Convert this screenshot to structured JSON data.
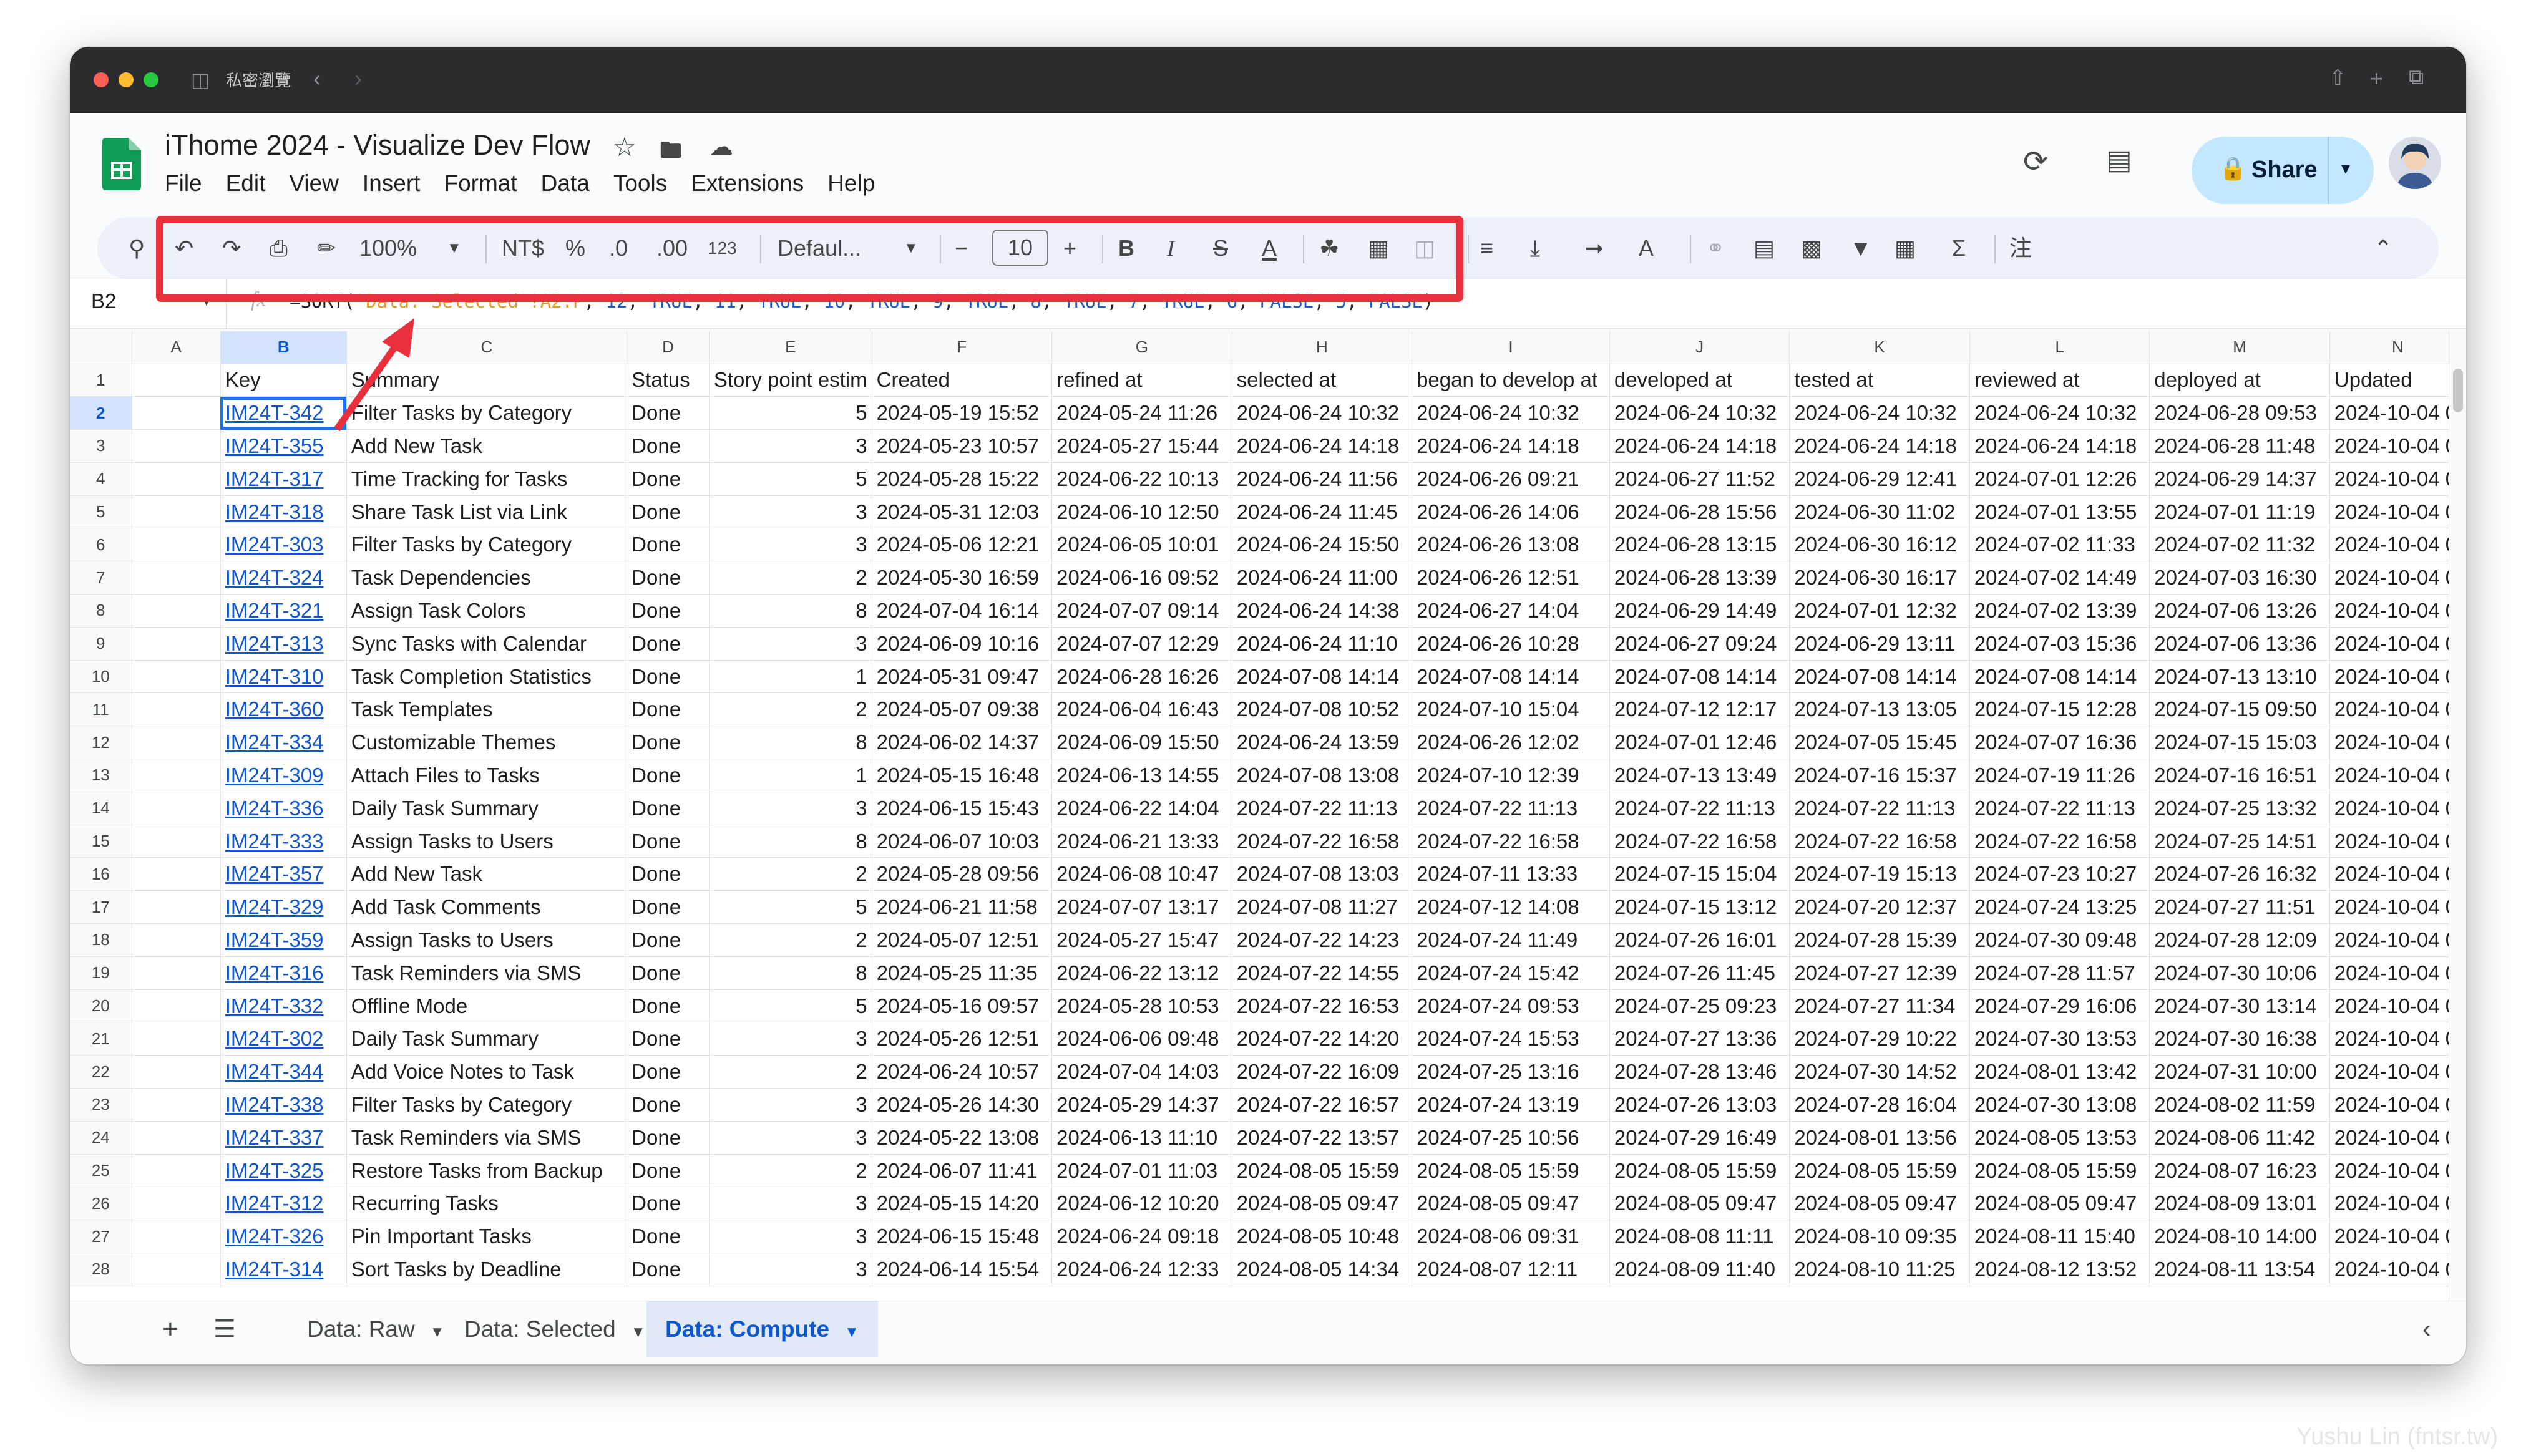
{
  "window": {
    "private_label": "私密瀏覽",
    "traffic_lights": [
      "#ff5f57",
      "#febc2e",
      "#28c840"
    ]
  },
  "app": {
    "title": "iThome 2024 - Visualize Dev Flow",
    "menus": [
      "File",
      "Edit",
      "View",
      "Insert",
      "Format",
      "Data",
      "Tools",
      "Extensions",
      "Help"
    ],
    "share_label": "Share"
  },
  "toolbar": {
    "zoom": "100%",
    "currency": "NT$",
    "percent": "%",
    "dec_less": ".0",
    "dec_more": ".00",
    "format_123": "123",
    "font": "Defaul...",
    "font_size": "10"
  },
  "formula_bar": {
    "cell_ref": "B2",
    "fx": "fx",
    "formula_parts": [
      {
        "t": "=SORT(",
        "c": "#1f1f1f"
      },
      {
        "t": "'Data: Selected'",
        "c": "#e59d27"
      },
      {
        "t": "!A2:P",
        "c": "#e59d27"
      },
      {
        "t": ", ",
        "c": "#1f1f1f"
      },
      {
        "t": "12",
        "c": "#1c5cc9"
      },
      {
        "t": ", ",
        "c": "#1f1f1f"
      },
      {
        "t": "TRUE",
        "c": "#1c5cc9"
      },
      {
        "t": ", ",
        "c": "#1f1f1f"
      },
      {
        "t": "11",
        "c": "#1c5cc9"
      },
      {
        "t": ", ",
        "c": "#1f1f1f"
      },
      {
        "t": "TRUE",
        "c": "#1c5cc9"
      },
      {
        "t": ", ",
        "c": "#1f1f1f"
      },
      {
        "t": "10",
        "c": "#1c5cc9"
      },
      {
        "t": ", ",
        "c": "#1f1f1f"
      },
      {
        "t": "TRUE",
        "c": "#1c5cc9"
      },
      {
        "t": ", ",
        "c": "#1f1f1f"
      },
      {
        "t": "9",
        "c": "#1c5cc9"
      },
      {
        "t": ", ",
        "c": "#1f1f1f"
      },
      {
        "t": "TRUE",
        "c": "#1c5cc9"
      },
      {
        "t": ", ",
        "c": "#1f1f1f"
      },
      {
        "t": "8",
        "c": "#1c5cc9"
      },
      {
        "t": ", ",
        "c": "#1f1f1f"
      },
      {
        "t": "TRUE",
        "c": "#1c5cc9"
      },
      {
        "t": ", ",
        "c": "#1f1f1f"
      },
      {
        "t": "7",
        "c": "#1c5cc9"
      },
      {
        "t": ", ",
        "c": "#1f1f1f"
      },
      {
        "t": "TRUE",
        "c": "#1c5cc9"
      },
      {
        "t": ", ",
        "c": "#1f1f1f"
      },
      {
        "t": "6",
        "c": "#1c5cc9"
      },
      {
        "t": ", ",
        "c": "#1f1f1f"
      },
      {
        "t": "FALSE",
        "c": "#1c5cc9"
      },
      {
        "t": ", ",
        "c": "#1f1f1f"
      },
      {
        "t": "5",
        "c": "#1c5cc9"
      },
      {
        "t": ", ",
        "c": "#1f1f1f"
      },
      {
        "t": "FALSE",
        "c": "#1c5cc9"
      },
      {
        "t": ")",
        "c": "#1f1f1f"
      }
    ]
  },
  "grid": {
    "column_letters": [
      "A",
      "B",
      "C",
      "D",
      "E",
      "F",
      "G",
      "H",
      "I",
      "J",
      "K",
      "L",
      "M",
      "N"
    ],
    "headers": [
      "",
      "Key",
      "Summary",
      "Status",
      "Story point estim",
      "Created",
      "refined at",
      "selected at",
      "began to develop at",
      "developed at",
      "tested at",
      "reviewed at",
      "deployed at",
      "Updated"
    ],
    "rows": [
      [
        "IM24T-342",
        "Filter Tasks by Category",
        "Done",
        "5",
        "2024-05-19 15:52",
        "2024-05-24 11:26",
        "2024-06-24 10:32",
        "2024-06-24 10:32",
        "2024-06-24 10:32",
        "2024-06-24 10:32",
        "2024-06-24 10:32",
        "2024-06-28 09:53",
        "2024-10-04 0"
      ],
      [
        "IM24T-355",
        "Add New Task",
        "Done",
        "3",
        "2024-05-23 10:57",
        "2024-05-27 15:44",
        "2024-06-24 14:18",
        "2024-06-24 14:18",
        "2024-06-24 14:18",
        "2024-06-24 14:18",
        "2024-06-24 14:18",
        "2024-06-28 11:48",
        "2024-10-04 0"
      ],
      [
        "IM24T-317",
        "Time Tracking for Tasks",
        "Done",
        "5",
        "2024-05-28 15:22",
        "2024-06-22 10:13",
        "2024-06-24 11:56",
        "2024-06-26 09:21",
        "2024-06-27 11:52",
        "2024-06-29 12:41",
        "2024-07-01 12:26",
        "2024-06-29 14:37",
        "2024-10-04 0"
      ],
      [
        "IM24T-318",
        "Share Task List via Link",
        "Done",
        "3",
        "2024-05-31 12:03",
        "2024-06-10 12:50",
        "2024-06-24 11:45",
        "2024-06-26 14:06",
        "2024-06-28 15:56",
        "2024-06-30 11:02",
        "2024-07-01 13:55",
        "2024-07-01 11:19",
        "2024-10-04 0"
      ],
      [
        "IM24T-303",
        "Filter Tasks by Category",
        "Done",
        "3",
        "2024-05-06 12:21",
        "2024-06-05 10:01",
        "2024-06-24 15:50",
        "2024-06-26 13:08",
        "2024-06-28 13:15",
        "2024-06-30 16:12",
        "2024-07-02 11:33",
        "2024-07-02 11:32",
        "2024-10-04 0"
      ],
      [
        "IM24T-324",
        "Task Dependencies",
        "Done",
        "2",
        "2024-05-30 16:59",
        "2024-06-16 09:52",
        "2024-06-24 11:00",
        "2024-06-26 12:51",
        "2024-06-28 13:39",
        "2024-06-30 16:17",
        "2024-07-02 14:49",
        "2024-07-03 16:30",
        "2024-10-04 0"
      ],
      [
        "IM24T-321",
        "Assign Task Colors",
        "Done",
        "8",
        "2024-07-04 16:14",
        "2024-07-07 09:14",
        "2024-06-24 14:38",
        "2024-06-27 14:04",
        "2024-06-29 14:49",
        "2024-07-01 12:32",
        "2024-07-02 13:39",
        "2024-07-06 13:26",
        "2024-10-04 0"
      ],
      [
        "IM24T-313",
        "Sync Tasks with Calendar",
        "Done",
        "3",
        "2024-06-09 10:16",
        "2024-07-07 12:29",
        "2024-06-24 11:10",
        "2024-06-26 10:28",
        "2024-06-27 09:24",
        "2024-06-29 13:11",
        "2024-07-03 15:36",
        "2024-07-06 13:36",
        "2024-10-04 0"
      ],
      [
        "IM24T-310",
        "Task Completion Statistics",
        "Done",
        "1",
        "2024-05-31 09:47",
        "2024-06-28 16:26",
        "2024-07-08 14:14",
        "2024-07-08 14:14",
        "2024-07-08 14:14",
        "2024-07-08 14:14",
        "2024-07-08 14:14",
        "2024-07-13 13:10",
        "2024-10-04 0"
      ],
      [
        "IM24T-360",
        "Task Templates",
        "Done",
        "2",
        "2024-05-07 09:38",
        "2024-06-04 16:43",
        "2024-07-08 10:52",
        "2024-07-10 15:04",
        "2024-07-12 12:17",
        "2024-07-13 13:05",
        "2024-07-15 12:28",
        "2024-07-15 09:50",
        "2024-10-04 0"
      ],
      [
        "IM24T-334",
        "Customizable Themes",
        "Done",
        "8",
        "2024-06-02 14:37",
        "2024-06-09 15:50",
        "2024-06-24 13:59",
        "2024-06-26 12:02",
        "2024-07-01 12:46",
        "2024-07-05 15:45",
        "2024-07-07 16:36",
        "2024-07-15 15:03",
        "2024-10-04 0"
      ],
      [
        "IM24T-309",
        "Attach Files to Tasks",
        "Done",
        "1",
        "2024-05-15 16:48",
        "2024-06-13 14:55",
        "2024-07-08 13:08",
        "2024-07-10 12:39",
        "2024-07-13 13:49",
        "2024-07-16 15:37",
        "2024-07-19 11:26",
        "2024-07-16 16:51",
        "2024-10-04 0"
      ],
      [
        "IM24T-336",
        "Daily Task Summary",
        "Done",
        "3",
        "2024-06-15 15:43",
        "2024-06-22 14:04",
        "2024-07-22 11:13",
        "2024-07-22 11:13",
        "2024-07-22 11:13",
        "2024-07-22 11:13",
        "2024-07-22 11:13",
        "2024-07-25 13:32",
        "2024-10-04 0"
      ],
      [
        "IM24T-333",
        "Assign Tasks to Users",
        "Done",
        "8",
        "2024-06-07 10:03",
        "2024-06-21 13:33",
        "2024-07-22 16:58",
        "2024-07-22 16:58",
        "2024-07-22 16:58",
        "2024-07-22 16:58",
        "2024-07-22 16:58",
        "2024-07-25 14:51",
        "2024-10-04 0"
      ],
      [
        "IM24T-357",
        "Add New Task",
        "Done",
        "2",
        "2024-05-28 09:56",
        "2024-06-08 10:47",
        "2024-07-08 13:03",
        "2024-07-11 13:33",
        "2024-07-15 15:04",
        "2024-07-19 15:13",
        "2024-07-23 10:27",
        "2024-07-26 16:32",
        "2024-10-04 0"
      ],
      [
        "IM24T-329",
        "Add Task Comments",
        "Done",
        "5",
        "2024-06-21 11:58",
        "2024-07-07 13:17",
        "2024-07-08 11:27",
        "2024-07-12 14:08",
        "2024-07-15 13:12",
        "2024-07-20 12:37",
        "2024-07-24 13:25",
        "2024-07-27 11:51",
        "2024-10-04 0"
      ],
      [
        "IM24T-359",
        "Assign Tasks to Users",
        "Done",
        "2",
        "2024-05-07 12:51",
        "2024-05-27 15:47",
        "2024-07-22 14:23",
        "2024-07-24 11:49",
        "2024-07-26 16:01",
        "2024-07-28 15:39",
        "2024-07-30 09:48",
        "2024-07-28 12:09",
        "2024-10-04 0"
      ],
      [
        "IM24T-316",
        "Task Reminders via SMS",
        "Done",
        "8",
        "2024-05-25 11:35",
        "2024-06-22 13:12",
        "2024-07-22 14:55",
        "2024-07-24 15:42",
        "2024-07-26 11:45",
        "2024-07-27 12:39",
        "2024-07-28 11:57",
        "2024-07-30 10:06",
        "2024-10-04 0"
      ],
      [
        "IM24T-332",
        "Offline Mode",
        "Done",
        "5",
        "2024-05-16 09:57",
        "2024-05-28 10:53",
        "2024-07-22 16:53",
        "2024-07-24 09:53",
        "2024-07-25 09:23",
        "2024-07-27 11:34",
        "2024-07-29 16:06",
        "2024-07-30 13:14",
        "2024-10-04 0"
      ],
      [
        "IM24T-302",
        "Daily Task Summary",
        "Done",
        "3",
        "2024-05-26 12:51",
        "2024-06-06 09:48",
        "2024-07-22 14:20",
        "2024-07-24 15:53",
        "2024-07-27 13:36",
        "2024-07-29 10:22",
        "2024-07-30 13:53",
        "2024-07-30 16:38",
        "2024-10-04 0"
      ],
      [
        "IM24T-344",
        "Add Voice Notes to Task",
        "Done",
        "2",
        "2024-06-24 10:57",
        "2024-07-04 14:03",
        "2024-07-22 16:09",
        "2024-07-25 13:16",
        "2024-07-28 13:46",
        "2024-07-30 14:52",
        "2024-08-01 13:42",
        "2024-07-31 10:00",
        "2024-10-04 0"
      ],
      [
        "IM24T-338",
        "Filter Tasks by Category",
        "Done",
        "3",
        "2024-05-26 14:30",
        "2024-05-29 14:37",
        "2024-07-22 16:57",
        "2024-07-24 13:19",
        "2024-07-26 13:03",
        "2024-07-28 16:04",
        "2024-07-30 13:08",
        "2024-08-02 11:59",
        "2024-10-04 0"
      ],
      [
        "IM24T-337",
        "Task Reminders via SMS",
        "Done",
        "3",
        "2024-05-22 13:08",
        "2024-06-13 11:10",
        "2024-07-22 13:57",
        "2024-07-25 10:56",
        "2024-07-29 16:49",
        "2024-08-01 13:56",
        "2024-08-05 13:53",
        "2024-08-06 11:42",
        "2024-10-04 0"
      ],
      [
        "IM24T-325",
        "Restore Tasks from Backup",
        "Done",
        "2",
        "2024-06-07 11:41",
        "2024-07-01 11:03",
        "2024-08-05 15:59",
        "2024-08-05 15:59",
        "2024-08-05 15:59",
        "2024-08-05 15:59",
        "2024-08-05 15:59",
        "2024-08-07 16:23",
        "2024-10-04 0"
      ],
      [
        "IM24T-312",
        "Recurring Tasks",
        "Done",
        "3",
        "2024-05-15 14:20",
        "2024-06-12 10:20",
        "2024-08-05 09:47",
        "2024-08-05 09:47",
        "2024-08-05 09:47",
        "2024-08-05 09:47",
        "2024-08-05 09:47",
        "2024-08-09 13:01",
        "2024-10-04 0"
      ],
      [
        "IM24T-326",
        "Pin Important Tasks",
        "Done",
        "3",
        "2024-06-15 15:48",
        "2024-06-24 09:18",
        "2024-08-05 10:48",
        "2024-08-06 09:31",
        "2024-08-08 11:11",
        "2024-08-10 09:35",
        "2024-08-11 15:40",
        "2024-08-10 14:00",
        "2024-10-04 0"
      ],
      [
        "IM24T-314",
        "Sort Tasks by Deadline",
        "Done",
        "3",
        "2024-06-14 15:54",
        "2024-06-24 12:33",
        "2024-08-05 14:34",
        "2024-08-07 12:11",
        "2024-08-09 11:40",
        "2024-08-10 11:25",
        "2024-08-12 13:52",
        "2024-08-11 13:54",
        "2024-10-04 0"
      ]
    ]
  },
  "sheets": {
    "tabs": [
      "Data: Raw",
      "Data: Selected",
      "Data: Compute"
    ],
    "active": "Data: Compute"
  },
  "watermark": "Yushu Lin (fntsr.tw)"
}
